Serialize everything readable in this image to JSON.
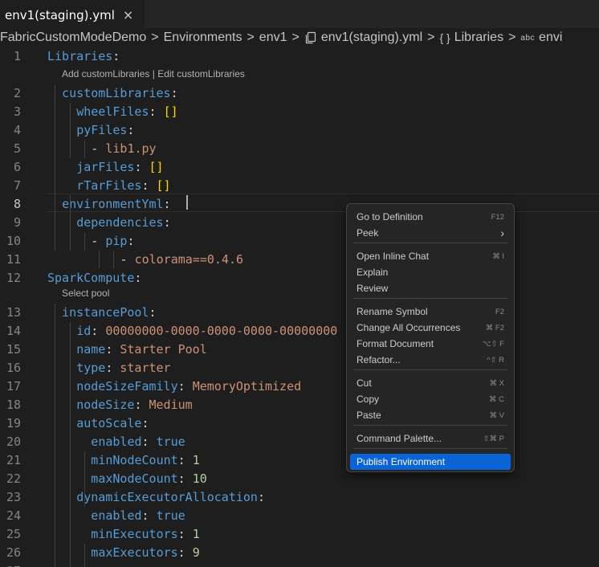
{
  "tab": {
    "title": "env1(staging).yml",
    "close_icon": "×"
  },
  "breadcrumb": {
    "items": [
      "FabricCustomModeDemo",
      "Environments",
      "env1",
      "env1(staging).yml",
      "Libraries",
      "envi"
    ],
    "separator": ">",
    "icons": {
      "file": "file-copy-icon",
      "object": "{ }",
      "string": "abc"
    }
  },
  "editor": {
    "lines": [
      {
        "n": "1",
        "segs": [
          [
            "k",
            "Libraries"
          ],
          [
            "p",
            ":"
          ]
        ]
      },
      {
        "n": "2",
        "segs": [
          [
            "k",
            "customLibraries"
          ],
          [
            "p",
            ":"
          ]
        ]
      },
      {
        "n": "3",
        "segs": [
          [
            "k",
            "wheelFiles"
          ],
          [
            "p",
            ": "
          ],
          [
            "b",
            "[]"
          ]
        ]
      },
      {
        "n": "4",
        "segs": [
          [
            "k",
            "pyFiles"
          ],
          [
            "p",
            ":"
          ]
        ]
      },
      {
        "n": "5",
        "segs": [
          [
            "p",
            "- "
          ],
          [
            "s",
            "lib1.py"
          ]
        ]
      },
      {
        "n": "6",
        "segs": [
          [
            "k",
            "jarFiles"
          ],
          [
            "p",
            ": "
          ],
          [
            "b",
            "[]"
          ]
        ]
      },
      {
        "n": "7",
        "segs": [
          [
            "k",
            "rTarFiles"
          ],
          [
            "p",
            ": "
          ],
          [
            "b",
            "[]"
          ]
        ]
      },
      {
        "n": "8",
        "segs": [
          [
            "k",
            "environmentYml"
          ],
          [
            "p",
            ": "
          ]
        ]
      },
      {
        "n": "9",
        "segs": [
          [
            "k",
            "dependencies"
          ],
          [
            "p",
            ":"
          ]
        ]
      },
      {
        "n": "10",
        "segs": [
          [
            "p",
            "- "
          ],
          [
            "k",
            "pip"
          ],
          [
            "p",
            ":"
          ]
        ]
      },
      {
        "n": "11",
        "segs": [
          [
            "p",
            "- "
          ],
          [
            "s",
            "colorama==0.4.6"
          ]
        ]
      },
      {
        "n": "12",
        "segs": [
          [
            "k",
            "SparkCompute"
          ],
          [
            "p",
            ":"
          ]
        ]
      },
      {
        "n": "13",
        "segs": [
          [
            "k",
            "instancePool"
          ],
          [
            "p",
            ":"
          ]
        ]
      },
      {
        "n": "14",
        "segs": [
          [
            "k",
            "id"
          ],
          [
            "p",
            ": "
          ],
          [
            "s",
            "00000000-0000-0000-0000-00000000"
          ]
        ]
      },
      {
        "n": "15",
        "segs": [
          [
            "k",
            "name"
          ],
          [
            "p",
            ": "
          ],
          [
            "s",
            "Starter Pool"
          ]
        ]
      },
      {
        "n": "16",
        "segs": [
          [
            "k",
            "type"
          ],
          [
            "p",
            ": "
          ],
          [
            "s",
            "starter"
          ]
        ]
      },
      {
        "n": "17",
        "segs": [
          [
            "k",
            "nodeSizeFamily"
          ],
          [
            "p",
            ": "
          ],
          [
            "s",
            "MemoryOptimized"
          ]
        ]
      },
      {
        "n": "18",
        "segs": [
          [
            "k",
            "nodeSize"
          ],
          [
            "p",
            ": "
          ],
          [
            "s",
            "Medium"
          ]
        ]
      },
      {
        "n": "19",
        "segs": [
          [
            "k",
            "autoScale"
          ],
          [
            "p",
            ":"
          ]
        ]
      },
      {
        "n": "20",
        "segs": [
          [
            "k",
            "enabled"
          ],
          [
            "p",
            ": "
          ],
          [
            "k",
            "true"
          ]
        ]
      },
      {
        "n": "21",
        "segs": [
          [
            "k",
            "minNodeCount"
          ],
          [
            "p",
            ": "
          ],
          [
            "n",
            "1"
          ]
        ]
      },
      {
        "n": "22",
        "segs": [
          [
            "k",
            "maxNodeCount"
          ],
          [
            "p",
            ": "
          ],
          [
            "n",
            "10"
          ]
        ]
      },
      {
        "n": "23",
        "segs": [
          [
            "k",
            "dynamicExecutorAllocation"
          ],
          [
            "p",
            ":"
          ]
        ]
      },
      {
        "n": "24",
        "segs": [
          [
            "k",
            "enabled"
          ],
          [
            "p",
            ": "
          ],
          [
            "k",
            "true"
          ]
        ]
      },
      {
        "n": "25",
        "segs": [
          [
            "k",
            "minExecutors"
          ],
          [
            "p",
            ": "
          ],
          [
            "n",
            "1"
          ]
        ]
      },
      {
        "n": "26",
        "segs": [
          [
            "k",
            "maxExecutors"
          ],
          [
            "p",
            ": "
          ],
          [
            "n",
            "9"
          ]
        ]
      },
      {
        "n": "27",
        "segs": []
      }
    ],
    "active_line": "8",
    "codelens": {
      "libraries": {
        "add": "Add customLibraries",
        "divider": " | ",
        "edit": "Edit customLibraries"
      },
      "spark": {
        "select": "Select pool"
      }
    }
  },
  "context_menu": {
    "items": [
      {
        "label": "Go to Definition",
        "shortcut": "F12"
      },
      {
        "label": "Peek",
        "submenu": "›"
      },
      {
        "label": "Open Inline Chat",
        "shortcut": "⌘ I"
      },
      {
        "label": "Explain",
        "shortcut": ""
      },
      {
        "label": "Review",
        "shortcut": ""
      },
      {
        "label": "Rename Symbol",
        "shortcut": "F2"
      },
      {
        "label": "Change All Occurrences",
        "shortcut": "⌘ F2"
      },
      {
        "label": "Format Document",
        "shortcut": "⌥⇧ F"
      },
      {
        "label": "Refactor...",
        "shortcut": "^⇧ R"
      },
      {
        "label": "Cut",
        "shortcut": "⌘ X"
      },
      {
        "label": "Copy",
        "shortcut": "⌘ C"
      },
      {
        "label": "Paste",
        "shortcut": "⌘ V"
      },
      {
        "label": "Command Palette...",
        "shortcut": "⇧⌘ P"
      },
      {
        "label": "Publish Environment",
        "shortcut": "",
        "highlighted": true
      }
    ],
    "highlight_color": "#0a64d6"
  },
  "colors": {
    "keyword": "#569cd6",
    "string": "#ce9178",
    "number": "#b5cea8",
    "bracket": "#ffd700",
    "background": "#1e1e1e"
  }
}
